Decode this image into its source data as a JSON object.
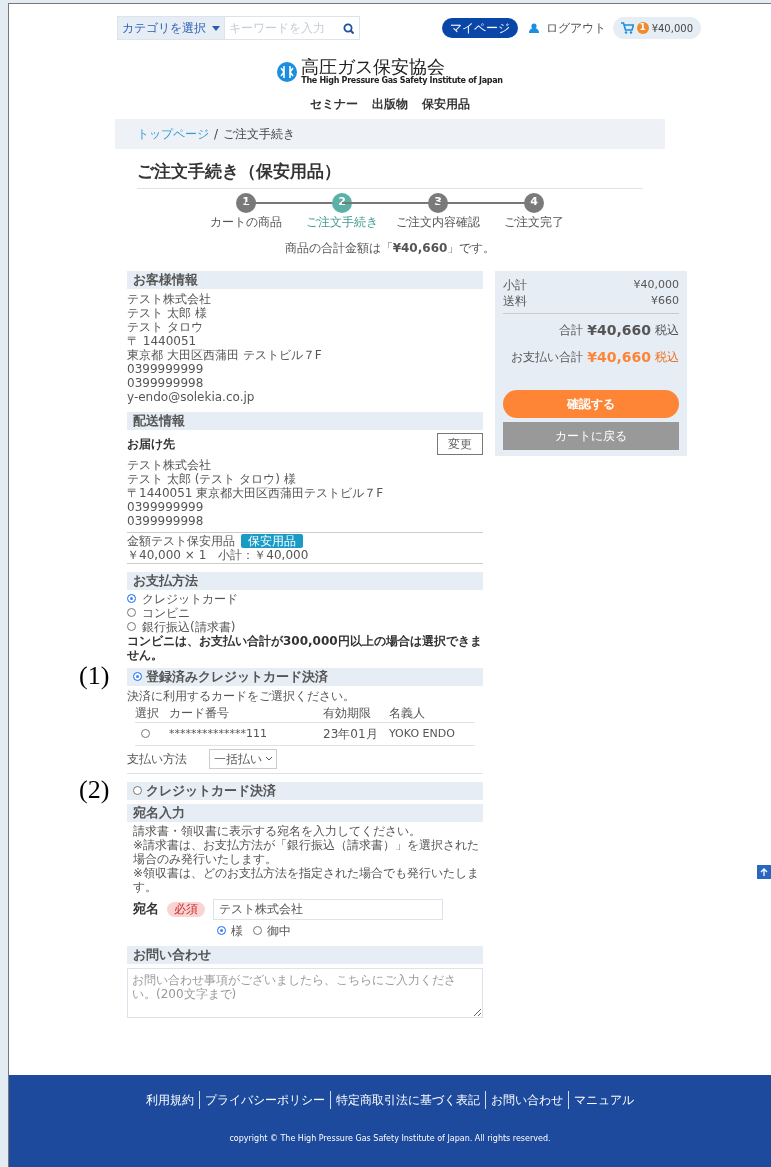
{
  "header": {
    "category_select": "カテゴリを選択",
    "search_placeholder": "キーワードを入力",
    "mypage_button": "マイページ",
    "logout_link": "ログアウト",
    "cart_count": "1",
    "cart_amount": "¥40,000"
  },
  "logo": {
    "title": "高圧ガス保安協会",
    "subtitle": "The High Pressure Gas Safety Institute of Japan"
  },
  "nav": [
    "セミナー",
    "出版物",
    "保安用品"
  ],
  "breadcrumb": {
    "items": [
      {
        "label": "トップページ",
        "link": true
      },
      {
        "label": "ご注文手続き",
        "link": false
      }
    ],
    "separator": "/"
  },
  "page_title": "ご注文手続き（保安用品）",
  "steps": [
    {
      "number": "1",
      "label": "カートの商品",
      "selected": false
    },
    {
      "number": "2",
      "label": "ご注文手続き",
      "selected": true
    },
    {
      "number": "3",
      "label": "ご注文内容確認",
      "selected": false
    },
    {
      "number": "4",
      "label": "ご注文完了",
      "selected": false
    }
  ],
  "total_message": "商品の合計金額は「**¥40,660**」です。",
  "customer": {
    "heading": "お客様情報",
    "lines": [
      "テスト株式会社",
      "テスト 太郎 様",
      "テスト タロウ",
      "〒 1440051",
      "東京都 大田区西蒲田 テストビル７F",
      "0399999999",
      "0399999998",
      "y-endo@solekia.co.jp"
    ]
  },
  "shipping": {
    "heading": "配送情報",
    "destination_label": "お届け先",
    "change_button": "変更",
    "lines": [
      "テスト株式会社",
      "テスト 太郎 (テスト タロウ) 様",
      "〒1440051 東京都大田区西蒲田テストビル７F",
      "0399999999",
      "0399999998"
    ],
    "item": {
      "name": "金額テスト保安用品",
      "tag": "保安用品",
      "detail": "￥40,000 × 1　小計：￥40,000"
    }
  },
  "payment": {
    "heading": "お支払方法",
    "options": [
      {
        "label": "クレジットカード",
        "selected": true
      },
      {
        "label": "コンビニ",
        "selected": false
      },
      {
        "label": "銀行振込(請求書)",
        "selected": false
      }
    ],
    "note": "コンビニは、お支払い合計が300,000円以上の場合は選択できません。"
  },
  "registered_card": {
    "marker": "(1)",
    "label": "登録済みクレジットカード決済",
    "selected": true,
    "instruction": "決済に利用するカードをご選択ください。",
    "columns": [
      "選択",
      "カード番号",
      "有効期限",
      "名義人"
    ],
    "rows": [
      {
        "selected": false,
        "card_number": "**************111",
        "expiry": "23年01月",
        "holder": "YOKO ENDO"
      }
    ],
    "installment_label": "支払い方法",
    "installment_value": "一括払い"
  },
  "credit_card": {
    "marker": "(2)",
    "label": "クレジットカード決済",
    "selected": false
  },
  "addressee": {
    "heading": "宛名入力",
    "notes": [
      "請求書・領収書に表示する宛名を入力してください。",
      "※請求書は、お支払方法が「銀行振込（請求書）」を選択された場合のみ発行いたします。",
      "※領収書は、どのお支払方法を指定された場合でも発行いたします。"
    ],
    "label": "宛名",
    "required": "必須",
    "value": "テスト株式会社",
    "honorifics": [
      {
        "label": "様",
        "selected": true
      },
      {
        "label": "御中",
        "selected": false
      }
    ]
  },
  "inquiry": {
    "heading": "お問い合わせ",
    "placeholder": "お問い合わせ事項がございましたら、こちらにご入力ください。(200文字まで)"
  },
  "summary": {
    "rows": [
      {
        "label": "小計",
        "value": "¥40,000"
      },
      {
        "label": "送料",
        "value": "¥660"
      }
    ],
    "total": {
      "label": "合計",
      "value": "¥40,660",
      "tax": "税込"
    },
    "payment_total": {
      "label": "お支払い合計",
      "value": "¥40,660",
      "tax": "税込"
    },
    "confirm_button": "確認する",
    "back_button": "カートに戻る"
  },
  "footer": {
    "links": [
      "利用規約",
      "プライバシーポリシー",
      "特定商取引法に基づく表記",
      "お問い合わせ",
      "マニュアル"
    ],
    "copyright": "copyright © The High Pressure Gas Safety Institute of Japan. All rights reserved."
  }
}
